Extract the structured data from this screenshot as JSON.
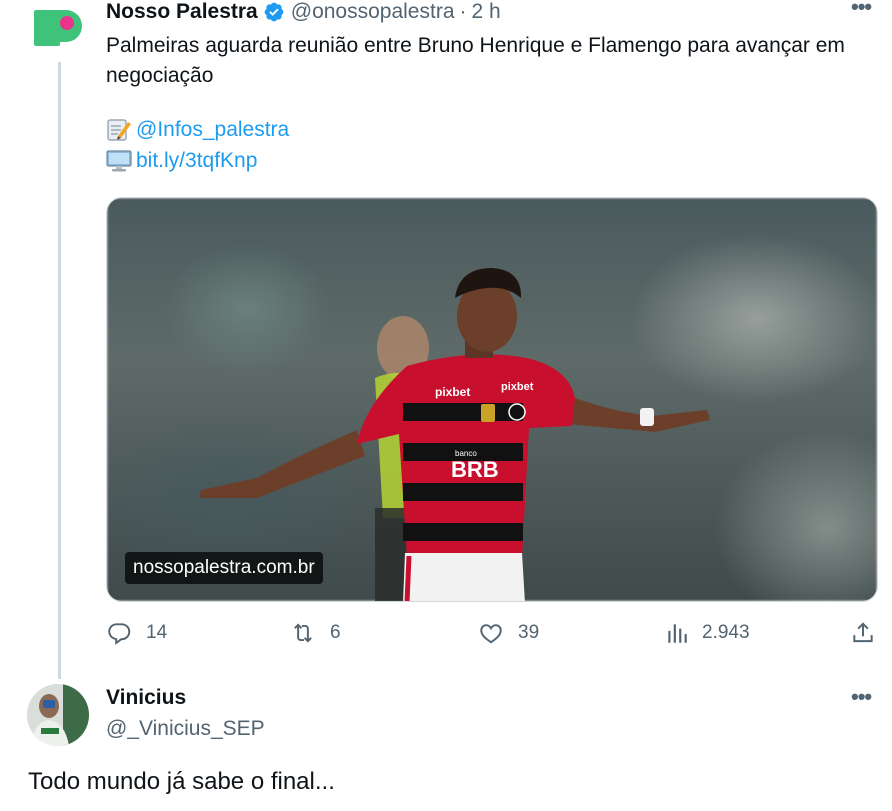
{
  "tweet": {
    "author_name": "Nosso Palestra",
    "author_handle": "@onossopalestra",
    "separator": "·",
    "time": "2 h",
    "text": "Palmeiras aguarda reunião entre Bruno Henrique e Flamengo para avançar em negociação",
    "links": [
      {
        "icon": "memo-icon",
        "text": "@Infos_palestra"
      },
      {
        "icon": "computer-icon",
        "text": "bit.ly/3tqfKnp"
      }
    ],
    "media": {
      "watermark": "nossopalestra.com.br",
      "jersey_texts": [
        "pixbet",
        "pixbet",
        "banco",
        "BRB"
      ]
    },
    "stats": {
      "replies": "14",
      "retweets": "6",
      "likes": "39",
      "views": "2.943"
    }
  },
  "reply": {
    "author_name": "Vinicius",
    "author_handle": "@_Vinicius_SEP",
    "text": "Todo mundo já sabe o final..."
  },
  "colors": {
    "verified": "#1d9bf0",
    "link": "#1d9bf0",
    "muted": "#536471",
    "brand_green": "#3fc37a",
    "brand_pink": "#e8358b",
    "flamengo_red": "#c8102e"
  }
}
